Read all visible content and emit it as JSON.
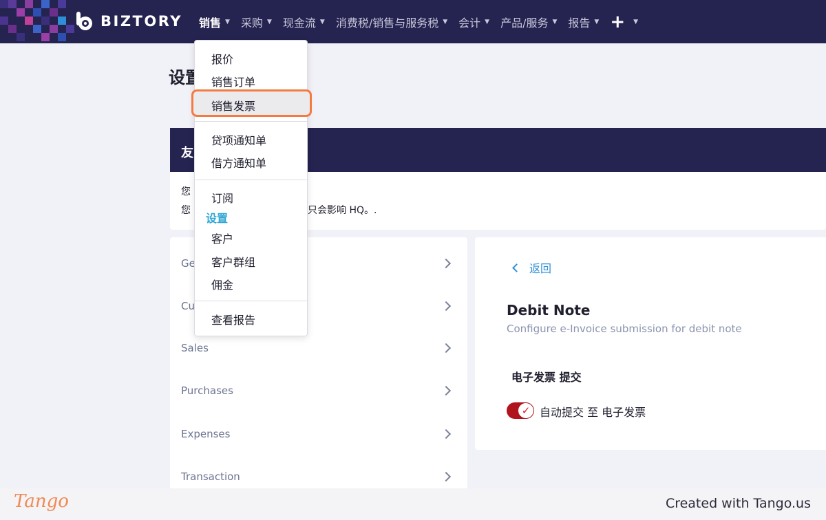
{
  "app": {
    "brand": "BIZTORY",
    "nav": [
      {
        "label": "销售",
        "active": true
      },
      {
        "label": "采购",
        "active": false
      },
      {
        "label": "现金流",
        "active": false
      },
      {
        "label": "消费税/销售与服务税",
        "active": false
      },
      {
        "label": "会计",
        "active": false
      },
      {
        "label": "产品/服务",
        "active": false
      },
      {
        "label": "报告",
        "active": false
      }
    ],
    "nav_plus": "+"
  },
  "dropdown": {
    "item_quote": "报价",
    "item_sales_order": "销售订单",
    "item_sales_invoice": "销售发票",
    "item_credit_note": "贷项通知单",
    "item_debit_note": "借方通知单",
    "item_subscription": "订阅",
    "header_settings": "设置",
    "item_customer": "客户",
    "item_customer_group": "客户群组",
    "item_commission": "佣金",
    "item_view_report": "查看报告"
  },
  "page": {
    "title": "设置",
    "banner_title": "友",
    "notice_line1": "您",
    "notice_line2_start": "您",
    "notice_line2_end": "只会影响 HQ。."
  },
  "settings_list": [
    {
      "label": "Ge"
    },
    {
      "label": "Cu"
    },
    {
      "label": "Sales"
    },
    {
      "label": "Purchases"
    },
    {
      "label": "Expenses"
    },
    {
      "label": "Transaction"
    }
  ],
  "detail": {
    "back_label": "返回",
    "title": "Debit Note",
    "subtitle": "Configure e-Invoice submission for debit note",
    "section_title": "电子发票 提交",
    "toggle_label": "自动提交 至 电子发票",
    "toggle_on": true
  },
  "footer": {
    "logo": "Tango",
    "created_text": "Created with Tango.us"
  },
  "colors": {
    "navbar": "#25234f",
    "accent_link": "#2f8fd6",
    "highlight_border": "#f47a40",
    "toggle_on": "#b0141c"
  }
}
